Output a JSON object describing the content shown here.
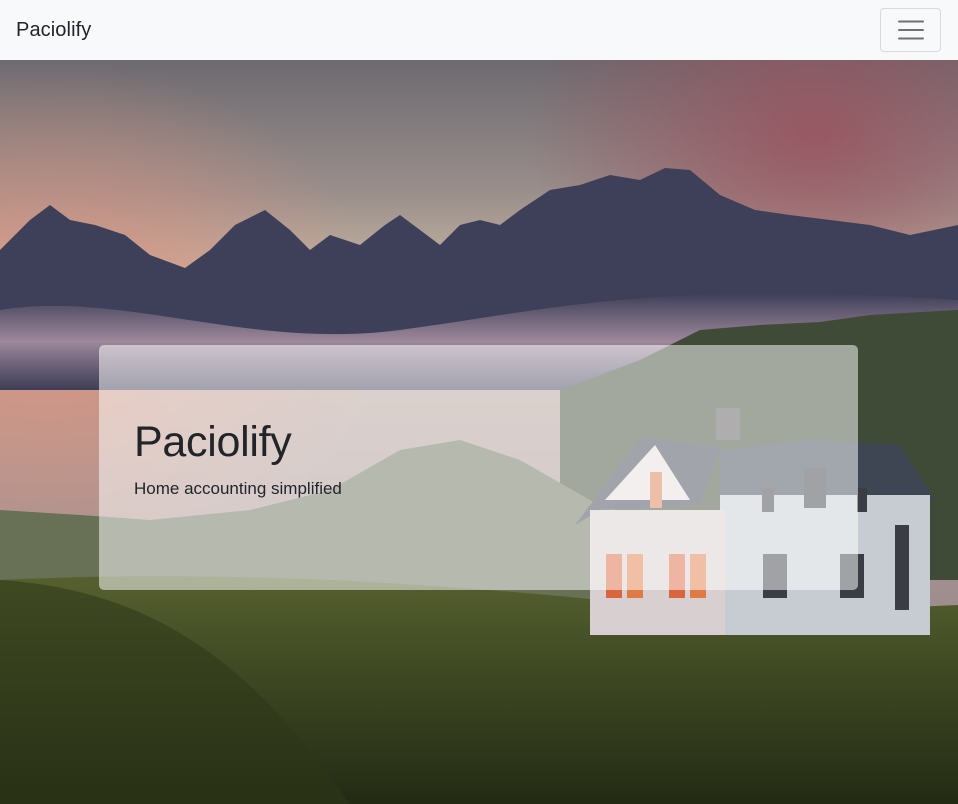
{
  "navbar": {
    "brand": "Paciolify",
    "toggler_icon": "hamburger-menu-icon"
  },
  "hero": {
    "background_image": "mountain-house-landscape",
    "jumbotron": {
      "title": "Paciolify",
      "lead": "Home accounting simplified"
    }
  },
  "colors": {
    "navbar_bg": "#f8f9fa",
    "text": "#212529",
    "grass": "#3f4a26",
    "mountain": "#3b3d56"
  }
}
